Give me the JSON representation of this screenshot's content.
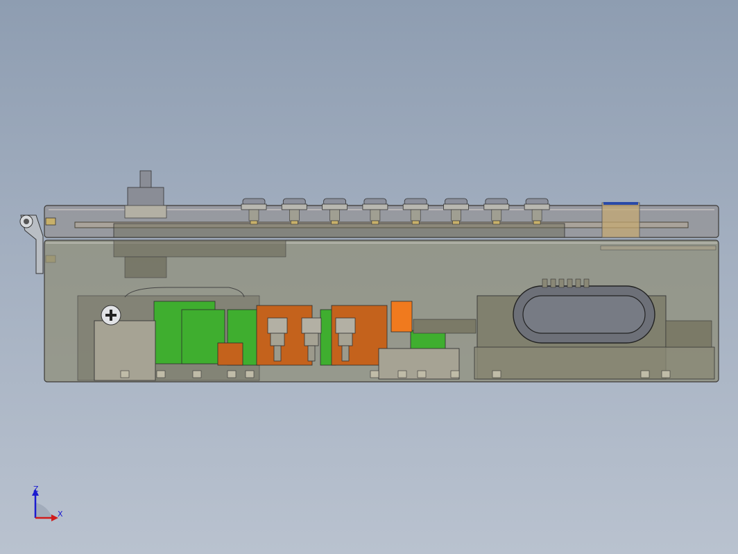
{
  "viewport": {
    "background_top": "#8e9db1",
    "background_bottom": "#b9c2cf",
    "view": "side-elevation"
  },
  "model": {
    "shell_color": "#8f8f7a",
    "pcb_green": "#3fae2f",
    "pcb_orange": "#c4621c",
    "bright_orange": "#f07a1e",
    "speaker_color": "#6d7078",
    "knob_count": 8
  },
  "triad": {
    "z_label": "Z",
    "x_label": "X",
    "axis_color": "#1b1bd0",
    "x_axis_color": "#d01b1b"
  }
}
